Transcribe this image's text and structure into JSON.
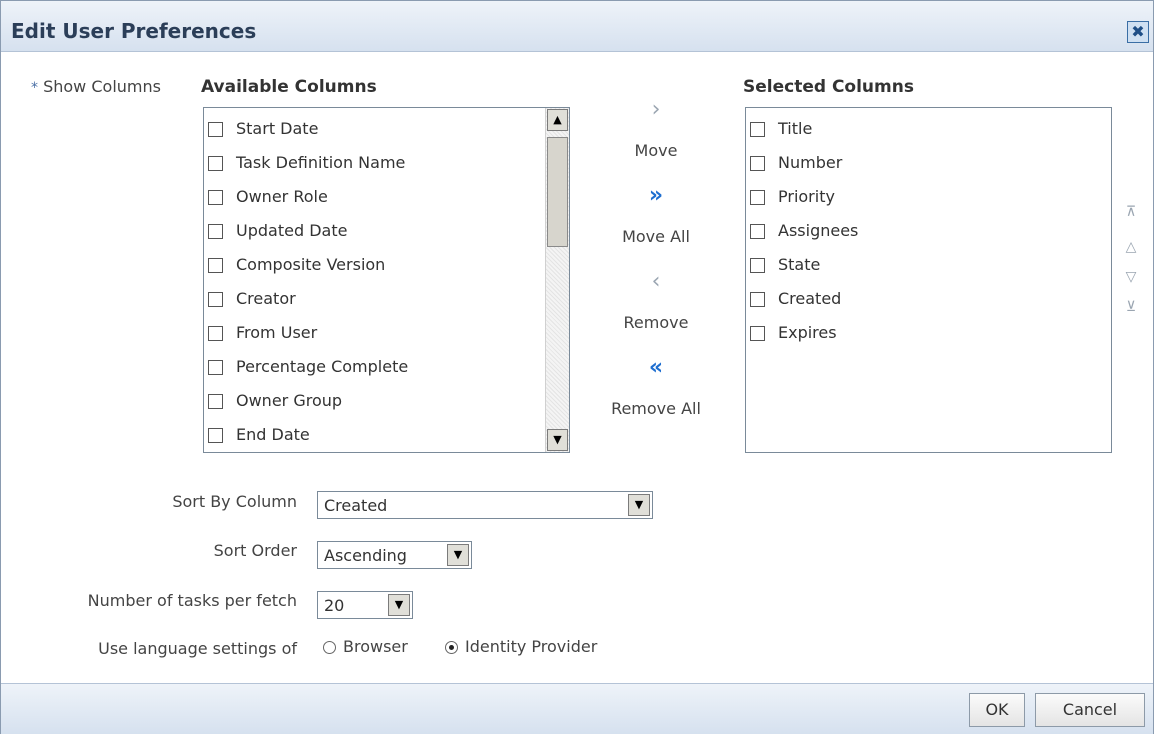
{
  "dialog": {
    "title": "Edit User Preferences",
    "close_glyph": "✖"
  },
  "show_columns": {
    "required_mark": "*",
    "label": "Show Columns",
    "available_header": "Available Columns",
    "selected_header": "Selected Columns",
    "available_items": [
      "Start Date",
      "Task Definition Name",
      "Owner Role",
      "Updated Date",
      "Composite Version",
      "Creator",
      "From User",
      "Percentage Complete",
      "Owner Group",
      "End Date"
    ],
    "selected_items": [
      "Title",
      "Number",
      "Priority",
      "Assignees",
      "State",
      "Created",
      "Expires"
    ],
    "scroll_up_glyph": "▲",
    "scroll_down_glyph": "▼"
  },
  "shuttle": {
    "move_icon": "chevron-right-icon",
    "move_glyph": "›",
    "move_label": "Move",
    "move_all_icon": "double-chevron-right-icon",
    "move_all_glyph": "»",
    "move_all_label": "Move All",
    "remove_icon": "chevron-left-icon",
    "remove_glyph": "‹",
    "remove_label": "Remove",
    "remove_all_icon": "double-chevron-left-icon",
    "remove_all_glyph": "«",
    "remove_all_label": "Remove All",
    "accent_color": "#1f6fd0",
    "disabled_color": "#9aa5b1"
  },
  "reorder": {
    "top_icon": "move-to-top-icon",
    "top_glyph": "⊼",
    "up_icon": "move-up-icon",
    "up_glyph": "△",
    "down_icon": "move-down-icon",
    "down_glyph": "▽",
    "bottom_icon": "move-to-bottom-icon",
    "bottom_glyph": "⊻"
  },
  "sort_by": {
    "label": "Sort By Column",
    "value": "Created"
  },
  "sort_order": {
    "label": "Sort Order",
    "value": "Ascending"
  },
  "tasks_per_fetch": {
    "label": "Number of tasks per fetch",
    "value": "20"
  },
  "language": {
    "label": "Use language settings of",
    "options": [
      {
        "label": "Browser",
        "selected": false
      },
      {
        "label": "Identity Provider",
        "selected": true
      }
    ]
  },
  "dropdown_glyph": "▼",
  "footer": {
    "ok_label": "OK",
    "cancel_label": "Cancel"
  }
}
